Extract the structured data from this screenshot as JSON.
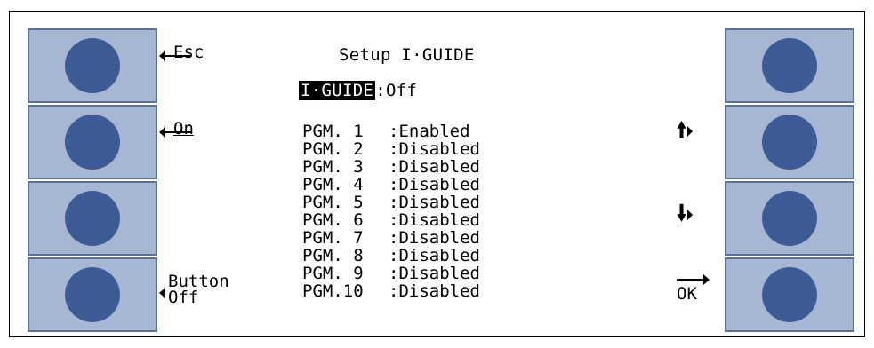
{
  "title": "Setup I·GUIDE",
  "status": {
    "label": "I·GUIDE",
    "separator": ":",
    "value": "Off"
  },
  "left_softkeys": [
    "Esc",
    "On",
    "",
    "Button\nOff"
  ],
  "right_softkeys": [
    "",
    "up-arrow-icon",
    "down-arrow-icon",
    "OK"
  ],
  "programs": [
    {
      "name": "PGM. 1",
      "state": ":Enabled"
    },
    {
      "name": "PGM. 2",
      "state": ":Disabled"
    },
    {
      "name": "PGM. 3",
      "state": ":Disabled"
    },
    {
      "name": "PGM. 4",
      "state": ":Disabled"
    },
    {
      "name": "PGM. 5",
      "state": ":Disabled"
    },
    {
      "name": "PGM. 6",
      "state": ":Disabled"
    },
    {
      "name": "PGM. 7",
      "state": ":Disabled"
    },
    {
      "name": "PGM. 8",
      "state": ":Disabled"
    },
    {
      "name": "PGM. 9",
      "state": ":Disabled"
    },
    {
      "name": "PGM.10",
      "state": ":Disabled"
    }
  ],
  "colors": {
    "key_face": "#a6b6d3",
    "key_dot": "#3d5c96",
    "key_border": "#5d6f92"
  }
}
